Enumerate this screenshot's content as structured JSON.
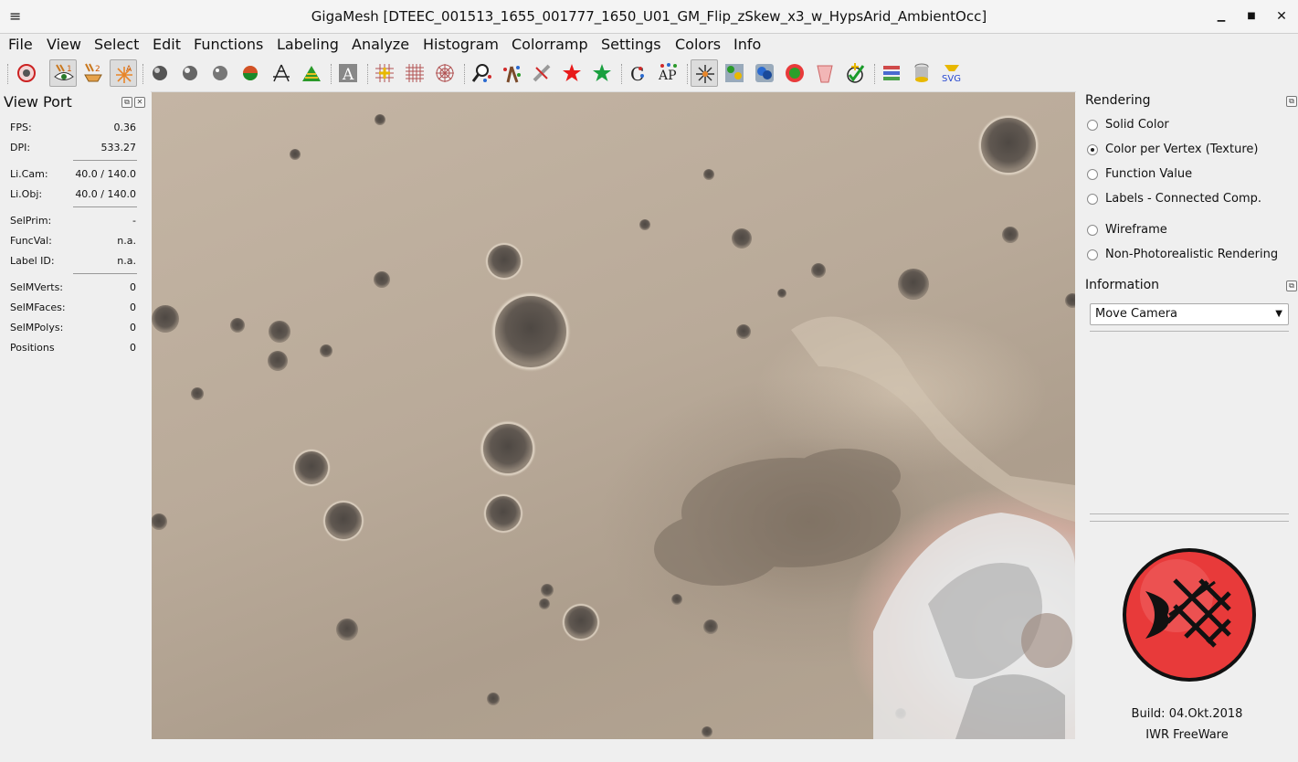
{
  "window": {
    "title": "GigaMesh [DTEEC_001513_1655_001777_1650_U01_GM_Flip_zSkew_x3_w_HypsArid_AmbientOcc]",
    "menu_icon": "≡",
    "minimize": "▁",
    "maximize": "■",
    "close": "✕"
  },
  "menubar": [
    {
      "label": "File"
    },
    {
      "label": "View"
    },
    {
      "label": "Select"
    },
    {
      "label": "Edit"
    },
    {
      "label": "Functions"
    },
    {
      "label": "Labeling"
    },
    {
      "label": "Analyze"
    },
    {
      "label": "Histogram"
    },
    {
      "label": "Colorramp"
    },
    {
      "label": "Settings"
    },
    {
      "label": "Colors"
    },
    {
      "label": "Info"
    }
  ],
  "toolbar": {
    "icons": [
      "reset-view-icon",
      "eye-view-1-icon",
      "view-2-icon",
      "light-a-icon",
      "sphere-m-icon",
      "sphere-d-icon",
      "sphere-s-icon",
      "sphere-a-icon",
      "axes-icon",
      "histogram-icon",
      "font-a-icon",
      "grid-plus-icon",
      "grid-icon",
      "polar-grid-icon",
      "search-stars-icon",
      "stars-figure-icon",
      "strike-icon",
      "red-star-icon",
      "green-star-icon",
      "c-star-icon",
      "ap-icon",
      "light-burst-icon",
      "colored-blobs-icon",
      "blue-spheres-icon",
      "green-flower-icon",
      "cone-icon",
      "check-plus-icon",
      "layers-icon",
      "cylinder-icon",
      "svg-export-icon"
    ]
  },
  "viewport_panel": {
    "title": "View Port",
    "rows": [
      {
        "label": "FPS:",
        "value": "0.36"
      },
      {
        "label": "DPI:",
        "value": "533.27"
      },
      {
        "label": "Li.Cam:",
        "value": "40.0 / 140.0"
      },
      {
        "label": "Li.Obj:",
        "value": "40.0 / 140.0"
      },
      {
        "label": "SelPrim:",
        "value": "-"
      },
      {
        "label": "FuncVal:",
        "value": "n.a."
      },
      {
        "label": "Label ID:",
        "value": "n.a."
      },
      {
        "label": "SelMVerts:",
        "value": "0"
      },
      {
        "label": "SelMFaces:",
        "value": "0"
      },
      {
        "label": "SelMPolys:",
        "value": "0"
      },
      {
        "label": "Positions",
        "value": "0"
      }
    ]
  },
  "rendering": {
    "title": "Rendering",
    "options": [
      {
        "label": "Solid Color",
        "checked": false
      },
      {
        "label": "Color per Vertex (Texture)",
        "checked": true
      },
      {
        "label": "Function Value",
        "checked": false
      },
      {
        "label": "Labels - Connected Comp.",
        "checked": false
      },
      {
        "label": "Wireframe",
        "checked": false
      },
      {
        "label": "Non-Photorealistic Rendering",
        "checked": false
      }
    ]
  },
  "information": {
    "title": "Information",
    "mode": "Move Camera"
  },
  "about": {
    "build": "Build: 04.Okt.2018",
    "license": "IWR FreeWare"
  },
  "colors": {
    "logo_red": "#e83a3a",
    "accent_frame": "#dcdcdc"
  }
}
